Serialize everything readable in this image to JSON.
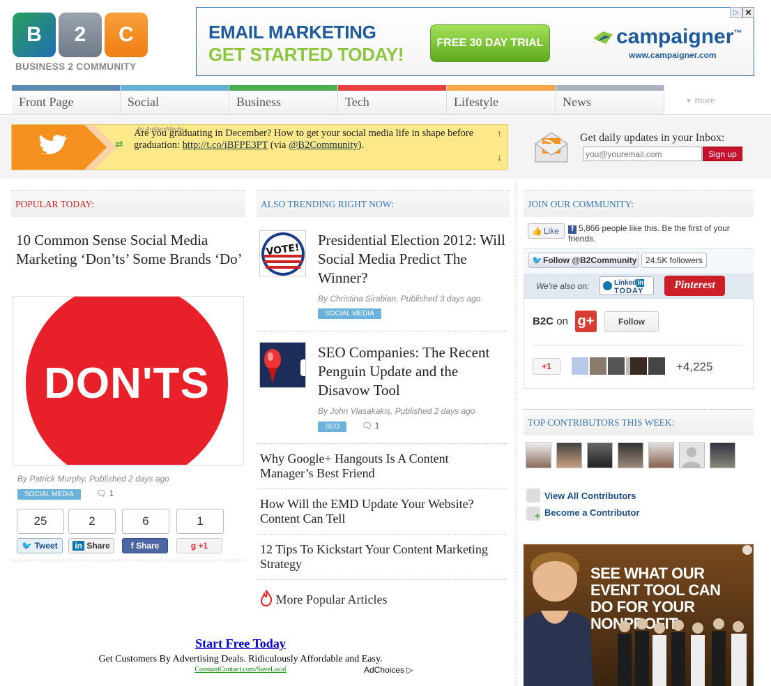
{
  "logo": {
    "letters": [
      "B",
      "2",
      "C"
    ],
    "text": "BUSINESS 2 COMMUNITY"
  },
  "banner_ad": {
    "line1": "EMAIL MARKETING",
    "line2": "GET STARTED TODAY!",
    "button": "FREE 30 DAY TRIAL",
    "brand": "campaigner",
    "tm": "™",
    "url": "www.campaigner.com",
    "corner": "▷",
    "close": "✕"
  },
  "nav": {
    "tabs": [
      {
        "label": "Front Page",
        "color": "#5b8ab5"
      },
      {
        "label": "Social",
        "color": "#6aaed6"
      },
      {
        "label": "Business",
        "color": "#4cae4c"
      },
      {
        "label": "Tech",
        "color": "#e84040"
      },
      {
        "label": "Lifestyle",
        "color": "#f5a84a"
      },
      {
        "label": "News",
        "color": "#a9b4bf"
      }
    ],
    "more": "more"
  },
  "tweet": {
    "user": "by ArtilleryMedia",
    "text_before": "Are you graduating in December? How to get your social media life in shape before graduation: ",
    "link": "http://t.co/iBFPE3PT",
    "text_mid": " (via ",
    "mention": "@B2Community",
    "text_after": ").",
    "up": "↑",
    "down": "↓",
    "retweet": "⇄"
  },
  "newsletter": {
    "title": "Get daily updates in your Inbox:",
    "placeholder": "you@youremail.com",
    "button": "Sign up"
  },
  "popular": {
    "header": "POPULAR TODAY:",
    "title": "10 Common Sense Social Media Marketing ‘Don’ts’ Some Brands ‘Do’",
    "image_text": "DON'TS",
    "meta": "By Patrick Murphy, Published 2 days ago",
    "tag": "SOCIAL MEDIA",
    "comments": "1",
    "share_counts": [
      "25",
      "2",
      "6",
      "1"
    ],
    "share_labels": [
      "Tweet",
      "Share",
      "Share",
      "+1"
    ]
  },
  "trending": {
    "header": "ALSO TRENDING RIGHT NOW:",
    "articles": [
      {
        "title": "Presidential Election 2012: Will Social Media Predict The Winner?",
        "meta": "By Christina Sirabian, Published 3 days ago",
        "tag": "SOCIAL MEDIA",
        "thumb_text": "VOTE!"
      },
      {
        "title": "SEO Companies: The Recent Penguin Update and the Disavow Tool",
        "meta": "By John Vlasakakis, Published 2 days ago",
        "tag": "SEO",
        "comments": "1"
      }
    ],
    "links": [
      "Why Google+ Hangouts Is A Content Manager’s Best Friend",
      "How Will the EMD Update Your Website? Content Can Tell",
      "12 Tips To Kickstart Your Content Marketing Strategy"
    ],
    "more": "More Popular Articles"
  },
  "community": {
    "header": "JOIN OUR COMMUNITY:",
    "like": "Like",
    "fb_text": "5,866 people like this. Be the first of your friends.",
    "follow": "Follow @B2Community",
    "followers": "24.5K followers",
    "also_on": "We're also on:",
    "linkedin": "Linked",
    "linkedin_in": "in",
    "today": "TODAY",
    "pinterest": "Pinterest",
    "b2c": "B2C",
    "on": "on",
    "gplus_follow": "Follow",
    "plus_one": "+1",
    "plus_count": "+4,225"
  },
  "contributors": {
    "header": "TOP CONTRIBUTORS THIS WEEK:",
    "view_all": "View All Contributors",
    "become": "Become a Contributor"
  },
  "nonprofit_ad": {
    "text": "SEE WHAT OUR EVENT TOOL CAN DO FOR YOUR NONPROFIT."
  },
  "bottom_ad": {
    "title": "Start Free Today",
    "desc": "Get Customers By Advertising Deals. Ridiculously Affordable and Easy.",
    "url": "ConstantContact.com/SaveLocal",
    "adchoices": "AdChoices"
  }
}
